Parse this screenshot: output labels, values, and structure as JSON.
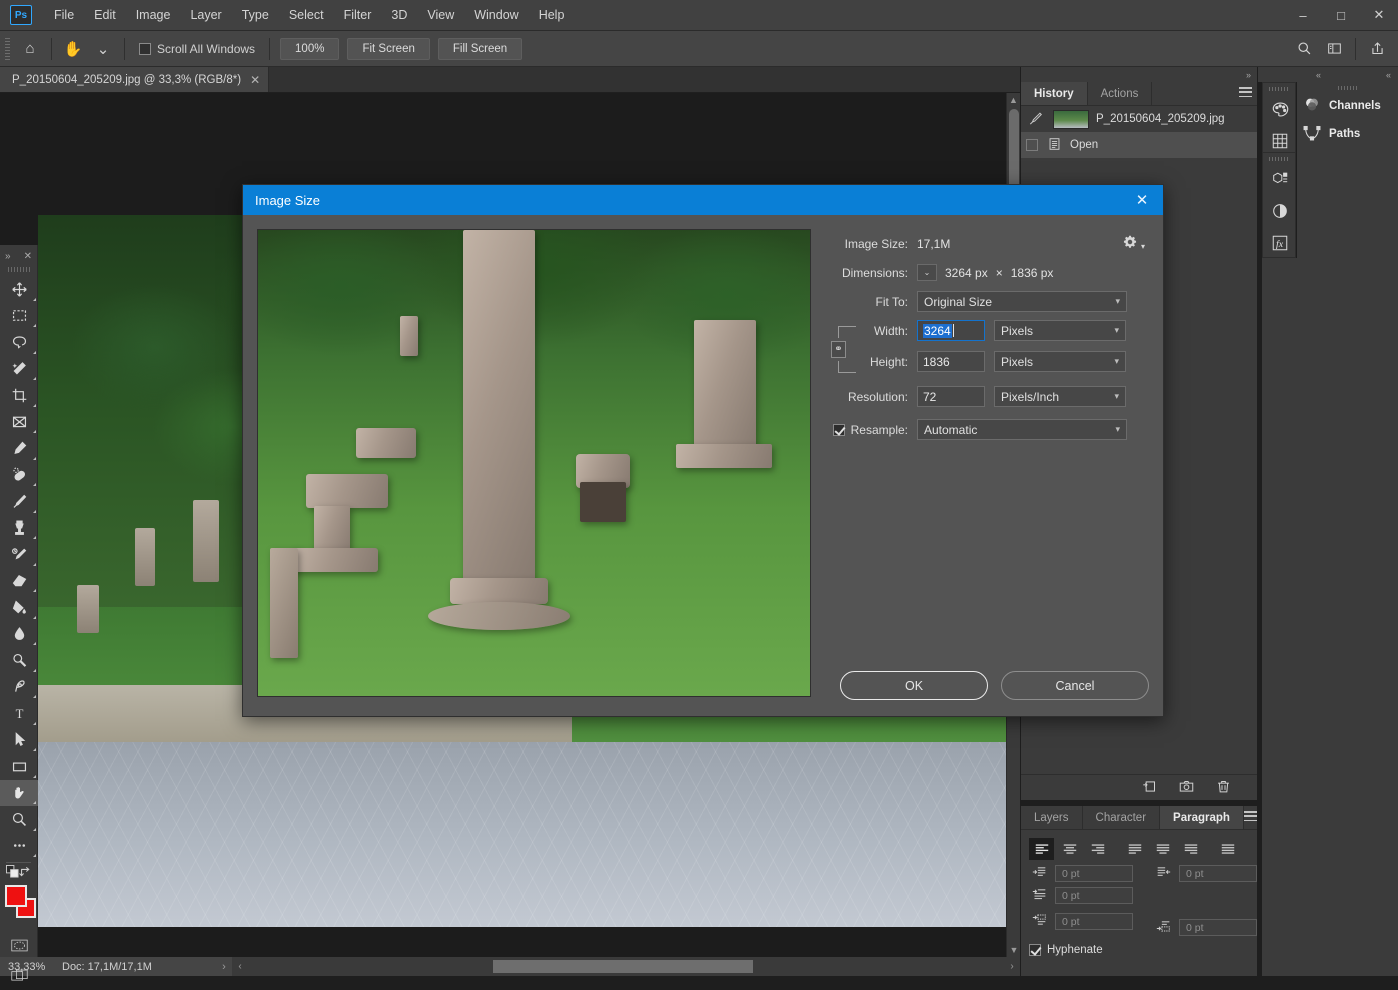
{
  "app": {
    "logo": "Ps",
    "menus": [
      "File",
      "Edit",
      "Image",
      "Layer",
      "Type",
      "Select",
      "Filter",
      "3D",
      "View",
      "Window",
      "Help"
    ],
    "window_controls": {
      "minimize": "–",
      "maximize": "□",
      "close": "✕"
    }
  },
  "options_bar": {
    "home_icon": "⌂",
    "tool_icon": "✋",
    "tool_dropdown": "⌄",
    "scroll_all_windows": {
      "label": "Scroll All Windows",
      "checked": false
    },
    "buttons": [
      "100%",
      "Fit Screen",
      "Fill Screen"
    ],
    "right_icons": [
      "search-icon",
      "workspace-icon",
      "share-icon"
    ]
  },
  "document_tab": {
    "title": "P_20150604_205209.jpg @ 33,3% (RGB/8*)",
    "close": "✕"
  },
  "toolbar": {
    "collapse": "»",
    "close": "✕",
    "tools": [
      {
        "name": "move-tool",
        "glyph": "move"
      },
      {
        "name": "rectangular-marquee-tool",
        "glyph": "marquee"
      },
      {
        "name": "lasso-tool",
        "glyph": "lasso"
      },
      {
        "name": "magic-wand-tool",
        "glyph": "wand"
      },
      {
        "name": "crop-tool",
        "glyph": "crop"
      },
      {
        "name": "frame-tool",
        "glyph": "frame"
      },
      {
        "name": "eyedropper-tool",
        "glyph": "eyedropper"
      },
      {
        "name": "spot-healing-brush-tool",
        "glyph": "healing"
      },
      {
        "name": "brush-tool",
        "glyph": "brush"
      },
      {
        "name": "clone-stamp-tool",
        "glyph": "stamp"
      },
      {
        "name": "history-brush-tool",
        "glyph": "historybrush"
      },
      {
        "name": "eraser-tool",
        "glyph": "eraser"
      },
      {
        "name": "gradient-tool",
        "glyph": "bucket"
      },
      {
        "name": "blur-tool",
        "glyph": "drop"
      },
      {
        "name": "dodge-tool",
        "glyph": "dodge"
      },
      {
        "name": "pen-tool",
        "glyph": "pen"
      },
      {
        "name": "type-tool",
        "glyph": "type"
      },
      {
        "name": "path-selection-tool",
        "glyph": "arrow"
      },
      {
        "name": "rectangle-tool",
        "glyph": "rect"
      },
      {
        "name": "hand-tool",
        "glyph": "hand",
        "active": true
      },
      {
        "name": "zoom-tool",
        "glyph": "zoom"
      },
      {
        "name": "edit-toolbar-tool",
        "glyph": "dots"
      }
    ],
    "foreground_color": "#ee1111",
    "background_color": "#ee1111",
    "quick_mask_label": "quick-mask-icon",
    "screen_mode_label": "screen-mode-icon"
  },
  "status_bar": {
    "zoom": "33,33%",
    "doc_info": "Doc: 17,1M/17,1M",
    "next_arrow": "›",
    "prev_arrow": "‹"
  },
  "history_panel": {
    "tabs": [
      {
        "label": "History",
        "active": true
      },
      {
        "label": "Actions",
        "active": false
      }
    ],
    "rows": [
      {
        "label": "P_20150604_205209.jpg",
        "type": "snapshot",
        "selected": false
      },
      {
        "label": "Open",
        "type": "state",
        "selected": true
      }
    ],
    "footer_icons": [
      "new-document-from-state-icon",
      "new-snapshot-icon",
      "delete-icon"
    ],
    "collapse_arrow": "»"
  },
  "paragraph_panel": {
    "tabs": [
      {
        "label": "Layers",
        "active": false
      },
      {
        "label": "Character",
        "active": false
      },
      {
        "label": "Paragraph",
        "active": true
      }
    ],
    "align_buttons": [
      "align-left",
      "align-center",
      "align-right",
      "justify-last-left",
      "justify-last-center",
      "justify-last-right",
      "justify-all"
    ],
    "indent_fields": [
      {
        "name": "indent-left-margin",
        "value": "0 pt"
      },
      {
        "name": "indent-right-margin",
        "value": "0 pt"
      },
      {
        "name": "indent-first-line",
        "value": "0 pt"
      },
      {
        "name": "space-before-paragraph",
        "value": "0 pt"
      },
      {
        "name": "space-after-paragraph",
        "value": "0 pt"
      }
    ],
    "hyphenate": {
      "label": "Hyphenate",
      "checked": true
    }
  },
  "right_rail": {
    "collapse_left": "«",
    "collapse_right": "«",
    "icons": [
      "color-palette-icon",
      "swatches-icon",
      "properties-icon",
      "adjustments-icon",
      "layer-styles-icon"
    ],
    "channels": [
      {
        "label": "Channels",
        "icon": "channels-icon"
      },
      {
        "label": "Paths",
        "icon": "paths-icon"
      }
    ]
  },
  "dialog": {
    "title": "Image Size",
    "close": "✕",
    "image_size_label": "Image Size:",
    "image_size_value": "17,1M",
    "gear_icon": "⚙",
    "dimensions_label": "Dimensions:",
    "dimensions_caret": "⌄",
    "dimensions_width": "3264 px",
    "dimensions_sep": "×",
    "dimensions_height": "1836 px",
    "fit_to_label": "Fit To:",
    "fit_to_value": "Original Size",
    "width_label": "Width:",
    "width_value": "3264",
    "width_unit": "Pixels",
    "height_label": "Height:",
    "height_value": "1836",
    "height_unit": "Pixels",
    "resolution_label": "Resolution:",
    "resolution_value": "72",
    "resolution_unit": "Pixels/Inch",
    "resample_label": "Resample:",
    "resample_checked": true,
    "resample_value": "Automatic",
    "link_icon": "⚭",
    "ok_label": "OK",
    "cancel_label": "Cancel"
  }
}
